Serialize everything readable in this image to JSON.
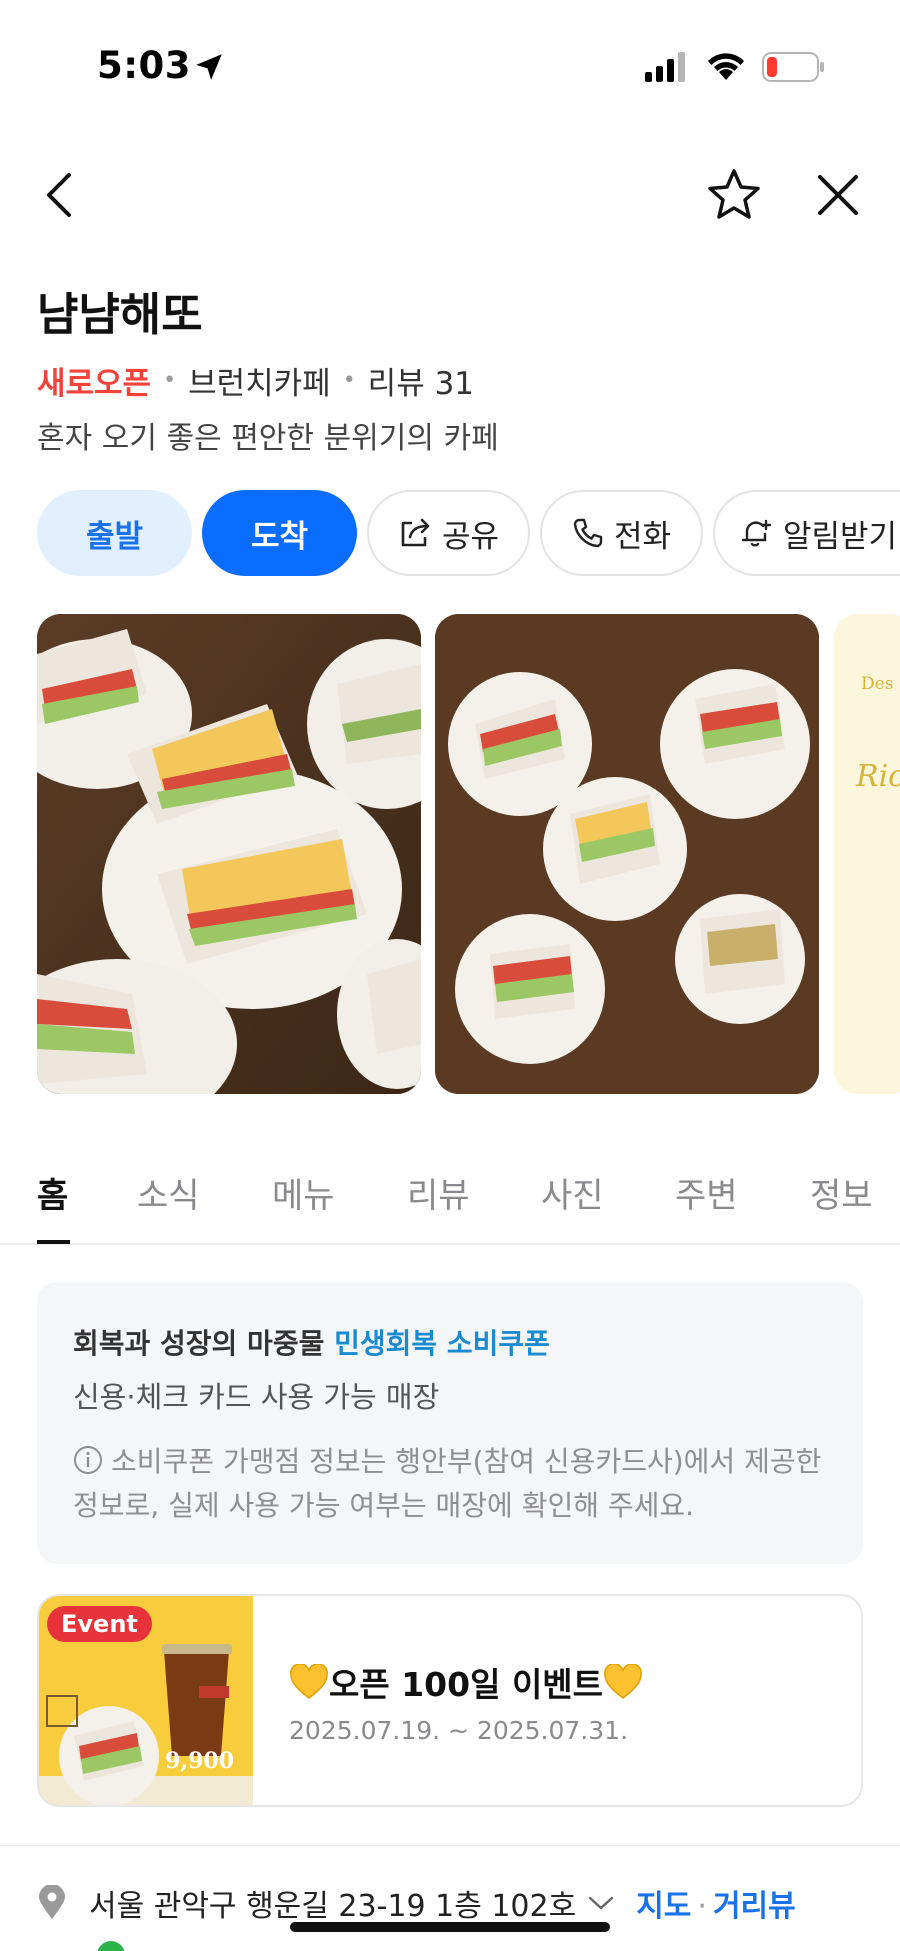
{
  "status_bar": {
    "time": "5:03"
  },
  "header": {
    "place_name": "냠냠해또",
    "tag_new": "새로오픈",
    "category": "브런치카페",
    "review": "리뷰 31",
    "description": "혼자 오기 좋은 편안한 분위기의 카페"
  },
  "actions": {
    "depart": "출발",
    "arrive": "도착",
    "share": "공유",
    "call": "전화",
    "alert": "알림받기"
  },
  "photos": {
    "third_text_1": "Des",
    "third_text_2": "Ric"
  },
  "tabs": [
    "홈",
    "소식",
    "메뉴",
    "리뷰",
    "사진",
    "주변",
    "정보"
  ],
  "coupon": {
    "head_prefix": "회복과 성장의 마중물",
    "head_highlight": "민생회복 소비쿠폰",
    "sub": "신용·체크 카드 사용 가능 매장",
    "note": "소비쿠폰 가맹점 정보는 행안부(참여 신용카드사)에서 제공한 정보로, 실제 사용 가능 여부는 매장에 확인해 주세요."
  },
  "event": {
    "badge": "Event",
    "title": "오픈 100일 이벤트",
    "date": "2025.07.19. ~ 2025.07.31.",
    "image_price": "9,900"
  },
  "address": {
    "text": "서울 관악구 행운길 23-19 1층 102호",
    "map_link": "지도",
    "street_link": "거리뷰"
  },
  "colors": {
    "accent": "#0a6dff",
    "new_tag": "#f2433b",
    "coupon_blue": "#1a8bd0"
  }
}
